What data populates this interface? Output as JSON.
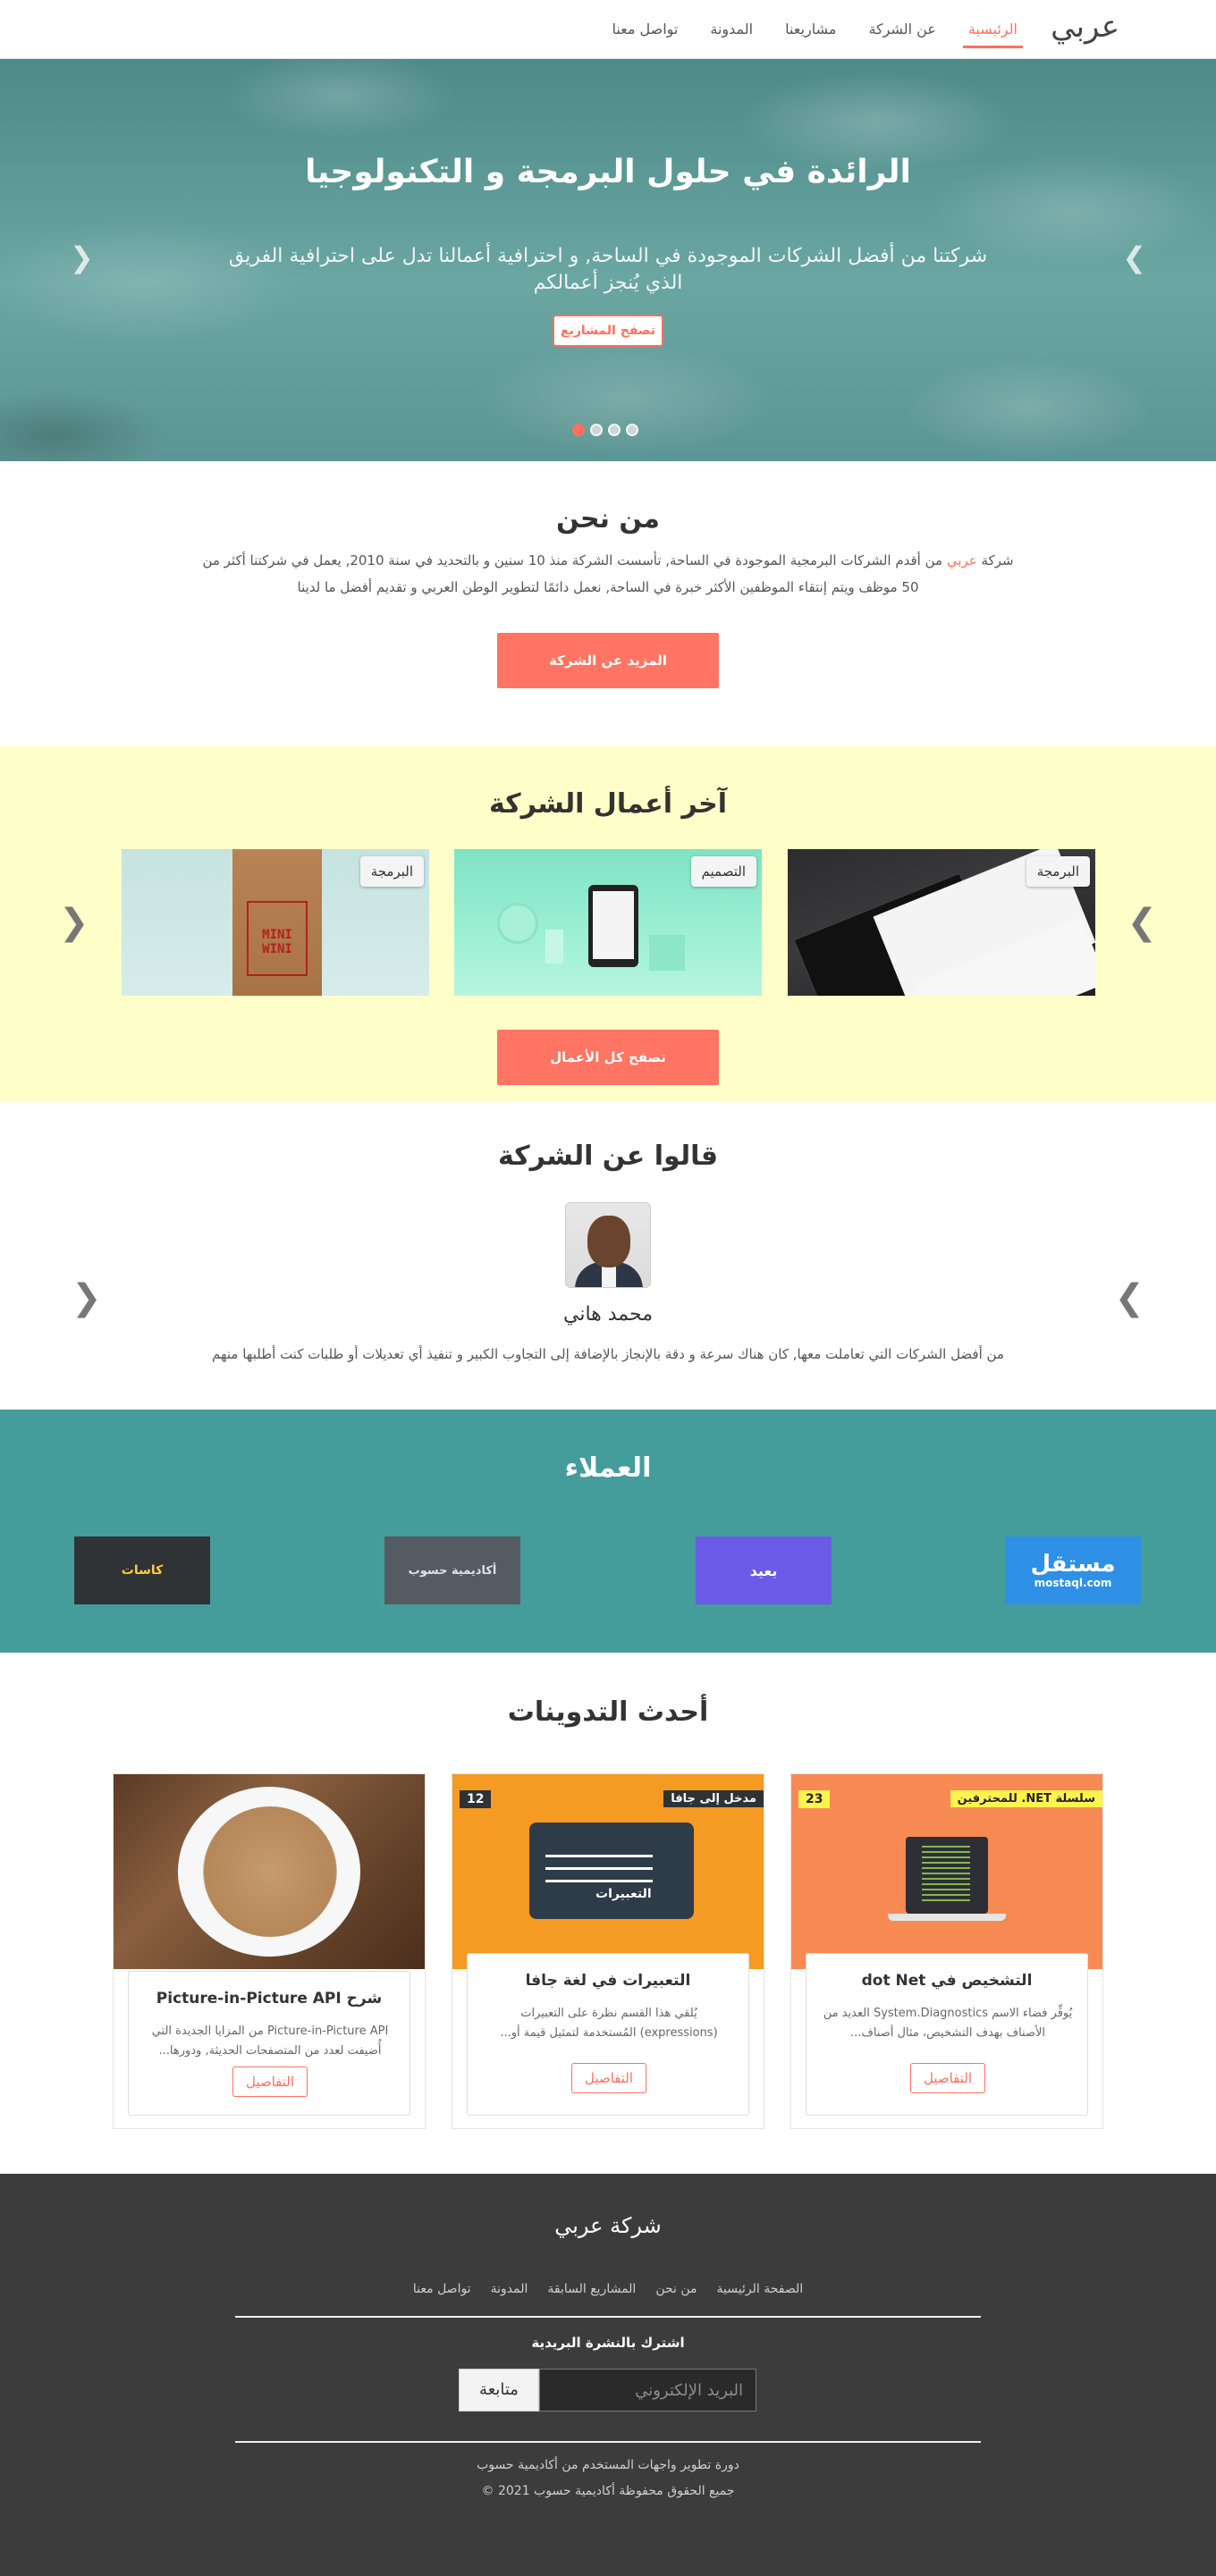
{
  "nav": {
    "brand": "عربي",
    "links": [
      {
        "label": "الرئيسية",
        "active": true
      },
      {
        "label": "عن الشركة",
        "active": false
      },
      {
        "label": "مشاريعنا",
        "active": false
      },
      {
        "label": "المدونة",
        "active": false
      },
      {
        "label": "تواصل معنا",
        "active": false
      }
    ]
  },
  "hero": {
    "title": "الرائدة في حلول البرمجة و التكنولوجيا",
    "subtitle": "شركتنا من أفضل الشركات الموجودة في الساحة, و احترافية أعمالنا تدل على احترافية الفريق الذي يُنجز أعمالكم",
    "button": "تصفح المشاريع",
    "prev_icon": "chevron-left-icon",
    "next_icon": "chevron-right-icon",
    "slide_count": 4,
    "active_slide": 1
  },
  "about": {
    "title": "من نحن",
    "text_pre": "شركة ",
    "text_highlight": "عربي",
    "text_post": " من أقدم الشركات البرمجية الموجودة في الساحة, تأسست الشركة منذ 10 سنين و بالتحديد في سنة 2010, يعمل في شركتنا أكثر من 50 موظف ويتم إنتقاء الموظفين الأكثر خبرة في الساحة, نعمل دائمًا لتطوير الوطن العربي و تقديم أفضل ما لدينا",
    "button": "المزيد عن الشركة"
  },
  "works": {
    "title": "آخر أعمال الشركة",
    "items": [
      {
        "category": "البرمجة"
      },
      {
        "category": "التصميم"
      },
      {
        "category": "البرمجة"
      }
    ],
    "mockup_text": "MINI WINI",
    "button": "تصفح كل الأعمال"
  },
  "testimonials": {
    "title": "قالوا عن الشركة",
    "name": "محمد هاني",
    "text": "من أفضل الشركات التي تعاملت معها, كان هناك سرعة و دقة بالإنجاز بالإضافة إلى التجاوب الكبير و تنفيذ أي تعديلات أو طلبات كنت أطلبها منهم"
  },
  "clients": {
    "title": "العملاء",
    "logos": [
      {
        "name": "مستقل",
        "sub": "mostaql.com",
        "color": "#2e90e6"
      },
      {
        "name": "بعيد",
        "color": "#6a5ae8"
      },
      {
        "name": "أكاديمية حسوب",
        "color": "#555b62"
      },
      {
        "name": "كاسات",
        "color": "#2f3336"
      }
    ]
  },
  "blog": {
    "title": "أحدث التدوينات",
    "posts": [
      {
        "series": "سلسلة NET. للمحترفين",
        "number": "23",
        "title": "التشخيص في dot Net",
        "excerpt": "يُوفِّر فضاء الاسم System.Diagnostics العديد من الأصناف بهدف التشخيص، مثال أصناف...",
        "button": "التفاصيل"
      },
      {
        "series": "مدخل إلى جافا",
        "number": "12",
        "image_text": "التعبيرات",
        "title": "التعبيرات في لغة جافا",
        "excerpt": "يُلقي هذا القسم نظرة على التعبيرات (expressions) المُستخدمة لتمثيل قيمة أو...",
        "button": "التفاصيل"
      },
      {
        "title": "شرح Picture-in-Picture API",
        "excerpt": "من المزايا الجديدة التي أُضيفت لعدد من المتصفحات الحديثة, ودورها...",
        "excerpt_lead": "Picture-in-Picture API",
        "button": "التفاصيل"
      }
    ]
  },
  "footer": {
    "brand": "شركة عربي",
    "links": [
      "الصفحة الرئيسية",
      "من نحن",
      "المشاريع السابقة",
      "المدونة",
      "تواصل معنا"
    ],
    "newsletter_label": "اشترك بالنشرة البريدية",
    "email_placeholder": "البريد الإلكتروني",
    "subscribe": "متابعة",
    "course": "دورة تطوير واجهات المستخدم من أكاديمية حسوب",
    "copyright": "جميع الحقوق محفوظة أكاديمية حسوب 2021 ©"
  }
}
